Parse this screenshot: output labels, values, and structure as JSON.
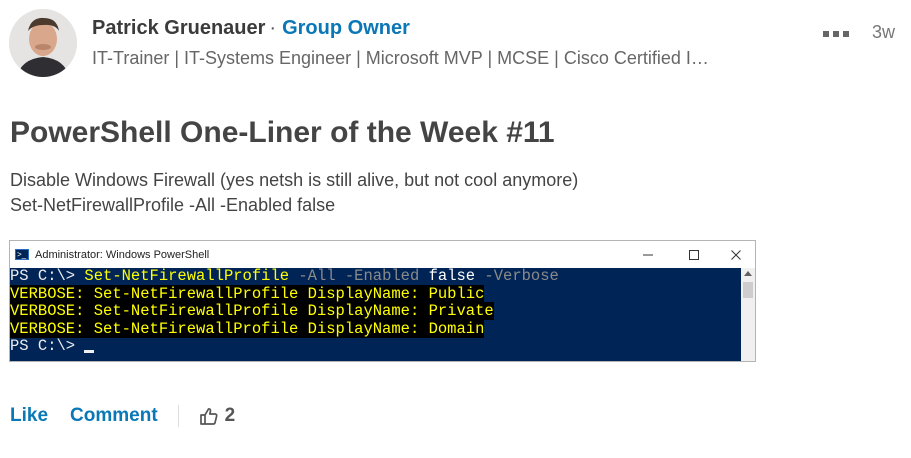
{
  "post": {
    "author_name": "Patrick Gruenauer",
    "separator": "·",
    "author_role": "Group Owner",
    "headline": "IT-Trainer | IT-Systems Engineer | Microsoft MVP | MCSE | Cisco Certified I…",
    "time_ago": "3w",
    "more_icon": "more-dots-icon",
    "title": "PowerShell One-Liner of the Week #11",
    "body_lines": [
      "Disable Windows Firewall (yes netsh is still alive, but not cool anymore)",
      "Set-NetFirewallProfile -All -Enabled false"
    ]
  },
  "screenshot": {
    "window_title": "Administrator: Windows PowerShell",
    "controls": {
      "minimize": "—",
      "maximize": "☐",
      "close": "✕"
    },
    "colors": {
      "console_bg": "#012456",
      "command": "#ffff00",
      "parameter": "#8a8a8a",
      "text": "#eeedf0"
    },
    "command_line": {
      "prompt": "PS C:\\> ",
      "cmdlet": "Set-NetFirewallProfile",
      "param1": " -All -Enabled ",
      "value": "false",
      "param2": " -Verbose"
    },
    "verbose_lines": [
      "VERBOSE: Set-NetFirewallProfile DisplayName: Public",
      "VERBOSE: Set-NetFirewallProfile DisplayName: Private",
      "VERBOSE: Set-NetFirewallProfile DisplayName: Domain"
    ],
    "final_prompt": "PS C:\\> "
  },
  "actions": {
    "like_label": "Like",
    "comment_label": "Comment",
    "like_icon": "thumbs-up-icon",
    "like_count": "2"
  },
  "accent_color": "#0a77b6"
}
